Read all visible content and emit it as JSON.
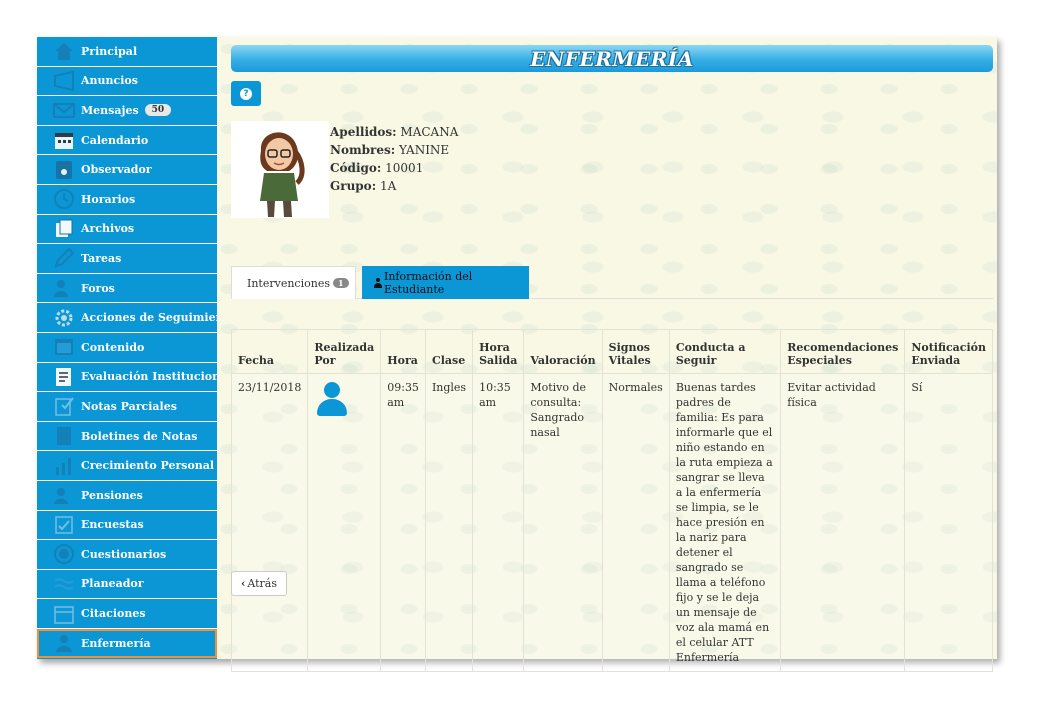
{
  "sidebar": {
    "items": [
      {
        "label": "Principal",
        "icon": "home-icon"
      },
      {
        "label": "Anuncios",
        "icon": "megaphone-icon"
      },
      {
        "label": "Mensajes",
        "icon": "envelope-icon",
        "badge": "50"
      },
      {
        "label": "Calendario",
        "icon": "calendar-icon"
      },
      {
        "label": "Observador",
        "icon": "document-icon"
      },
      {
        "label": "Horarios",
        "icon": "clock-icon"
      },
      {
        "label": "Archivos",
        "icon": "files-icon"
      },
      {
        "label": "Tareas",
        "icon": "pencil-icon"
      },
      {
        "label": "Foros",
        "icon": "forum-icon"
      },
      {
        "label": "Acciones de Seguimiento",
        "icon": "gear-icon"
      },
      {
        "label": "Contenido",
        "icon": "content-icon"
      },
      {
        "label": "Evaluación Institucional",
        "icon": "checklist-icon"
      },
      {
        "label": "Notas Parciales",
        "icon": "grades-icon"
      },
      {
        "label": "Boletines de Notas",
        "icon": "report-icon"
      },
      {
        "label": "Crecimiento Personal",
        "icon": "chart-icon"
      },
      {
        "label": "Pensiones",
        "icon": "money-icon"
      },
      {
        "label": "Encuestas",
        "icon": "survey-icon"
      },
      {
        "label": "Cuestionarios",
        "icon": "quiz-icon"
      },
      {
        "label": "Planeador",
        "icon": "planner-icon"
      },
      {
        "label": "Citaciones",
        "icon": "appointment-icon"
      },
      {
        "label": "Enfermería",
        "icon": "nurse-icon",
        "active": true
      }
    ]
  },
  "header": {
    "title": "ENFERMERÍA"
  },
  "student": {
    "apellidos_label": "Apellidos:",
    "apellidos": "MACANA",
    "nombres_label": "Nombres:",
    "nombres": "YANINE",
    "codigo_label": "Código:",
    "codigo": "10001",
    "grupo_label": "Grupo:",
    "grupo": "1A"
  },
  "tabs": {
    "interventions": "Intervenciones",
    "interventions_count": "1",
    "student_info": "Información del Estudiante"
  },
  "table": {
    "headers": [
      "Fecha",
      "Realizada Por",
      "Hora",
      "Clase",
      "Hora Salida",
      "Valoración",
      "Signos Vitales",
      "Conducta a Seguir",
      "Recomendaciones Especiales",
      "Notificación Enviada"
    ],
    "rows": [
      {
        "fecha": "23/11/2018",
        "hora": "09:35 am",
        "clase": "Ingles",
        "hora_salida": "10:35 am",
        "valoracion": "Motivo de consulta: Sangrado nasal",
        "signos": "Normales",
        "conducta": "Buenas tardes padres de familia: Es para informarle que el niño estando en la ruta empieza a sangrar se lleva a la enfermería se limpia, se le hace presión en la nariz para detener el sangrado se llama a teléfono fijo y se le deja un mensaje de voz ala mamá en el celular ATT Enfermería",
        "recomendaciones": "Evitar actividad física",
        "notificacion": "Sí"
      }
    ]
  },
  "back_label": "Atrás",
  "colors": {
    "brand": "#0b97d6",
    "active_outline": "#e8923b",
    "background": "#f8f8e5"
  }
}
